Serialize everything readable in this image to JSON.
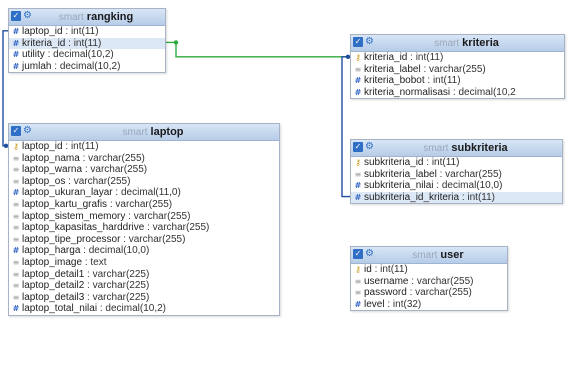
{
  "tables": [
    {
      "id": "rangking",
      "db": "smart",
      "name": "rangking",
      "fields": [
        {
          "name": "laptop_id",
          "type": "int(11)",
          "icon": "num-icon"
        },
        {
          "name": "kriteria_id",
          "type": "int(11)",
          "icon": "num-icon",
          "highlight": true
        },
        {
          "name": "utility",
          "type": "decimal(10,2)",
          "icon": "num-icon"
        },
        {
          "name": "jumlah",
          "type": "decimal(10,2)",
          "icon": "num-icon"
        }
      ]
    },
    {
      "id": "laptop",
      "db": "smart",
      "name": "laptop",
      "fields": [
        {
          "name": "laptop_id",
          "type": "int(11)",
          "icon": "key-icon"
        },
        {
          "name": "laptop_nama",
          "type": "varchar(255)",
          "icon": "text-icon"
        },
        {
          "name": "laptop_warna",
          "type": "varchar(255)",
          "icon": "text-icon"
        },
        {
          "name": "laptop_os",
          "type": "varchar(255)",
          "icon": "text-icon"
        },
        {
          "name": "laptop_ukuran_layar",
          "type": "decimal(11,0)",
          "icon": "num-icon"
        },
        {
          "name": "laptop_kartu_grafis",
          "type": "varchar(255)",
          "icon": "text-icon"
        },
        {
          "name": "laptop_sistem_memory",
          "type": "varchar(255)",
          "icon": "text-icon"
        },
        {
          "name": "laptop_kapasitas_harddrive",
          "type": "varchar(255)",
          "icon": "text-icon"
        },
        {
          "name": "laptop_tipe_processor",
          "type": "varchar(255)",
          "icon": "text-icon"
        },
        {
          "name": "laptop_harga",
          "type": "decimal(10,0)",
          "icon": "num-icon"
        },
        {
          "name": "laptop_image",
          "type": "text",
          "icon": "text-icon"
        },
        {
          "name": "laptop_detail1",
          "type": "varchar(225)",
          "icon": "text-icon"
        },
        {
          "name": "laptop_detail2",
          "type": "varchar(225)",
          "icon": "text-icon"
        },
        {
          "name": "laptop_detail3",
          "type": "varchar(225)",
          "icon": "text-icon"
        },
        {
          "name": "laptop_total_nilai",
          "type": "decimal(10,2)",
          "icon": "num-icon"
        }
      ]
    },
    {
      "id": "kriteria",
      "db": "smart",
      "name": "kriteria",
      "fields": [
        {
          "name": "kriteria_id",
          "type": "int(11)",
          "icon": "key-icon"
        },
        {
          "name": "kriteria_label",
          "type": "varchar(255)",
          "icon": "text-icon"
        },
        {
          "name": "kriteria_bobot",
          "type": "int(11)",
          "icon": "num-icon"
        },
        {
          "name": "kriteria_normalisasi",
          "type": "decimal(10,2",
          "icon": "num-icon"
        }
      ]
    },
    {
      "id": "subkriteria",
      "db": "smart",
      "name": "subkriteria",
      "fields": [
        {
          "name": "subkriteria_id",
          "type": "int(11)",
          "icon": "key-icon"
        },
        {
          "name": "subkriteria_label",
          "type": "varchar(255)",
          "icon": "text-icon"
        },
        {
          "name": "subkriteria_nilai",
          "type": "decimal(10,0)",
          "icon": "num-icon"
        },
        {
          "name": "subkriteria_id_kriteria",
          "type": "int(11)",
          "icon": "num-icon",
          "highlight": true
        }
      ]
    },
    {
      "id": "user",
      "db": "smart",
      "name": "user",
      "fields": [
        {
          "name": "id",
          "type": "int(11)",
          "icon": "key-icon"
        },
        {
          "name": "username",
          "type": "varchar(255)",
          "icon": "text-icon"
        },
        {
          "name": "password",
          "type": "varchar(255)",
          "icon": "text-icon"
        },
        {
          "name": "level",
          "type": "int(32)",
          "icon": "num-icon"
        }
      ]
    }
  ],
  "relations": [
    {
      "from": "rangking.laptop_id",
      "to": "laptop.laptop_id",
      "color": "#1f4e9e"
    },
    {
      "from": "rangking.kriteria_id",
      "to": "kriteria.kriteria_id",
      "color": "#2eaa3e"
    },
    {
      "from": "subkriteria.subkriteria_id_kriteria",
      "to": "kriteria.kriteria_id",
      "color": "#1f4e9e"
    }
  ],
  "colors": {
    "header_top": "#d8e6f6",
    "header_bottom": "#b6cce8",
    "highlight_row": "#dde8f6"
  }
}
